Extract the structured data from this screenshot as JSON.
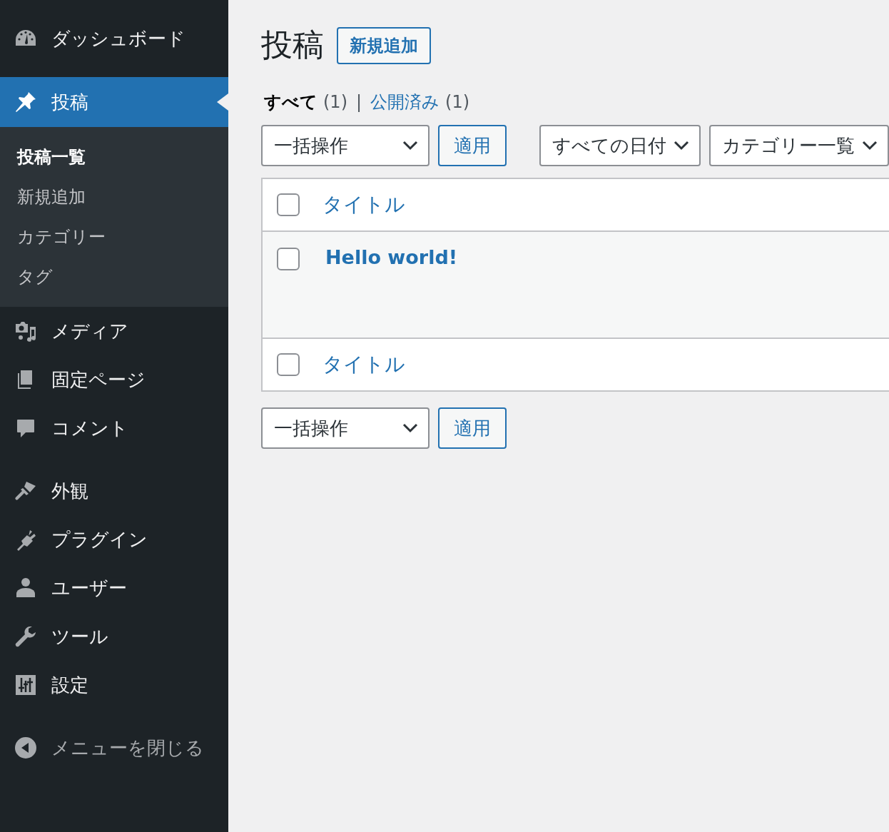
{
  "sidebar": {
    "groups": [
      [
        {
          "label": "ダッシュボード",
          "selected": false
        }
      ],
      [
        {
          "label": "投稿",
          "selected": true,
          "children": [
            {
              "label": "投稿一覧",
              "selected": true
            },
            {
              "label": "新規追加",
              "selected": false
            },
            {
              "label": "カテゴリー",
              "selected": false
            },
            {
              "label": "タグ",
              "selected": false
            }
          ]
        },
        {
          "label": "メディア",
          "selected": false
        },
        {
          "label": "固定ページ",
          "selected": false
        },
        {
          "label": "コメント",
          "selected": false
        }
      ],
      [
        {
          "label": "外観",
          "selected": false
        },
        {
          "label": "プラグイン",
          "selected": false
        },
        {
          "label": "ユーザー",
          "selected": false
        },
        {
          "label": "ツール",
          "selected": false
        },
        {
          "label": "設定",
          "selected": false
        }
      ]
    ],
    "collapse": {
      "label": "メニューを閉じる"
    }
  },
  "page": {
    "title": "投稿",
    "add_new": "新規追加"
  },
  "views": {
    "separator": "|",
    "items": [
      {
        "label": "すべて",
        "count": "(1)",
        "selected": true
      },
      {
        "label": "公開済み",
        "count": "(1)",
        "selected": false
      }
    ]
  },
  "top_filters": {
    "bulk_actions": "一括操作",
    "apply": "適用",
    "date_filter": "すべての日付",
    "category_filter": "カテゴリー一覧"
  },
  "table": {
    "header": {
      "column": "タイトル",
      "checked": false
    },
    "rows": [
      {
        "title": "Hello world!",
        "checked": false
      }
    ],
    "footer": {
      "column": "タイトル",
      "checked": false
    }
  },
  "bottom_filters": {
    "bulk_actions": "一括操作",
    "apply": "適用"
  }
}
